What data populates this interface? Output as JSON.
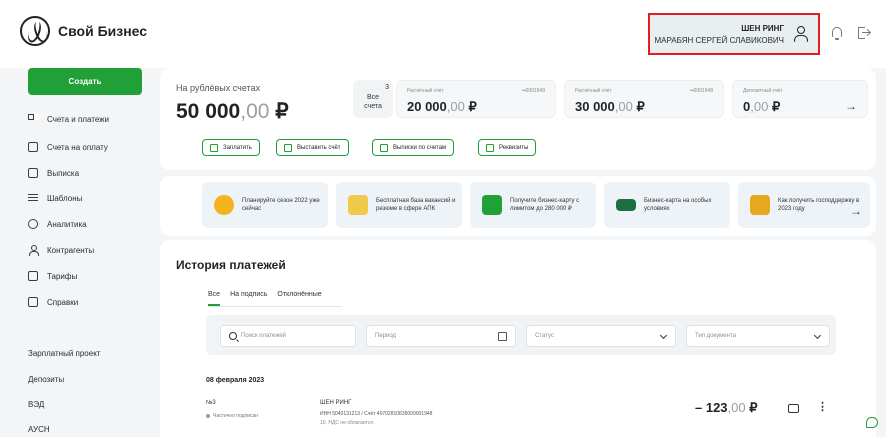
{
  "brand": {
    "name": "Свой Бизнес"
  },
  "user": {
    "short_name": "ШЕН РИНГ",
    "full_name": "МАРАБЯН СЕРГЕЙ СЛАВИКОВИЧ"
  },
  "sidebar": {
    "create_label": "Создать",
    "items": [
      {
        "label": "Счета и платежи",
        "icon": "accounts-grid-icon"
      },
      {
        "label": "Счета на оплату",
        "icon": "invoice-icon"
      },
      {
        "label": "Выписка",
        "icon": "statement-icon"
      },
      {
        "label": "Шаблоны",
        "icon": "templates-list-icon"
      },
      {
        "label": "Аналитика",
        "icon": "analytics-icon"
      },
      {
        "label": "Контрагенты",
        "icon": "counterparty-icon"
      },
      {
        "label": "Тарифы",
        "icon": "tariffs-icon"
      },
      {
        "label": "Справки",
        "icon": "certificates-icon"
      }
    ],
    "bottom_items": [
      "Зарплатный проект",
      "Депозиты",
      "ВЭД",
      "АУСН"
    ]
  },
  "balance": {
    "label": "На рублёвых счетах",
    "int": "50 000",
    "dec": ",00",
    "currency": "₽",
    "all_accounts_label_1": "Все",
    "all_accounts_label_2": "счета",
    "accounts_count": "3"
  },
  "accounts": [
    {
      "name": "Расчётный счёт",
      "num": "••0001949",
      "int": "20 000",
      "dec": ",00",
      "cur": "₽"
    },
    {
      "name": "Расчётный счёт",
      "num": "••0001948",
      "int": "30 000",
      "dec": ",00",
      "cur": "₽"
    },
    {
      "name": "Депозитный счёт",
      "num": "",
      "int": "0",
      "dec": ",00",
      "cur": "₽"
    }
  ],
  "actions": [
    "Заплатить",
    "Выставить счёт",
    "Выписки по счетам",
    "Реквизиты"
  ],
  "promos": [
    {
      "text": "Планируйте сезон 2022 уже сейчас",
      "color": "#f5b21c"
    },
    {
      "text": "Бесплатная база вакансий и резюме в сфере АПК",
      "color": "#f0c84a"
    },
    {
      "text": "Получите бизнес-карту с лимитом до 280 000 ₽",
      "color": "#21a038"
    },
    {
      "text": "Бизнес-карта на особых условиях",
      "color": "#1d6f42"
    },
    {
      "text": "Как получить господдержку в 2023 году",
      "color": "#e6a81f"
    }
  ],
  "history": {
    "title": "История платежей",
    "tabs": [
      "Все",
      "На подпись",
      "Отклонённые"
    ],
    "search_placeholder": "Поиск платежей",
    "period_placeholder": "Период",
    "status_placeholder": "Статус",
    "doctype_placeholder": "Тип документа",
    "date": "08 февраля 2023",
    "payment": {
      "number": "№3",
      "status": "Частично подписан",
      "recipient": "ШЕН РИНГ",
      "details": "ИНН 5040131213 / Счёт 40702810635000001948",
      "vat": "10, НДС не облагается",
      "amount_int": "– 123",
      "amount_dec": ",00",
      "currency": "₽"
    }
  },
  "colors": {
    "accent": "#21a038",
    "highlight": "#e02020"
  }
}
